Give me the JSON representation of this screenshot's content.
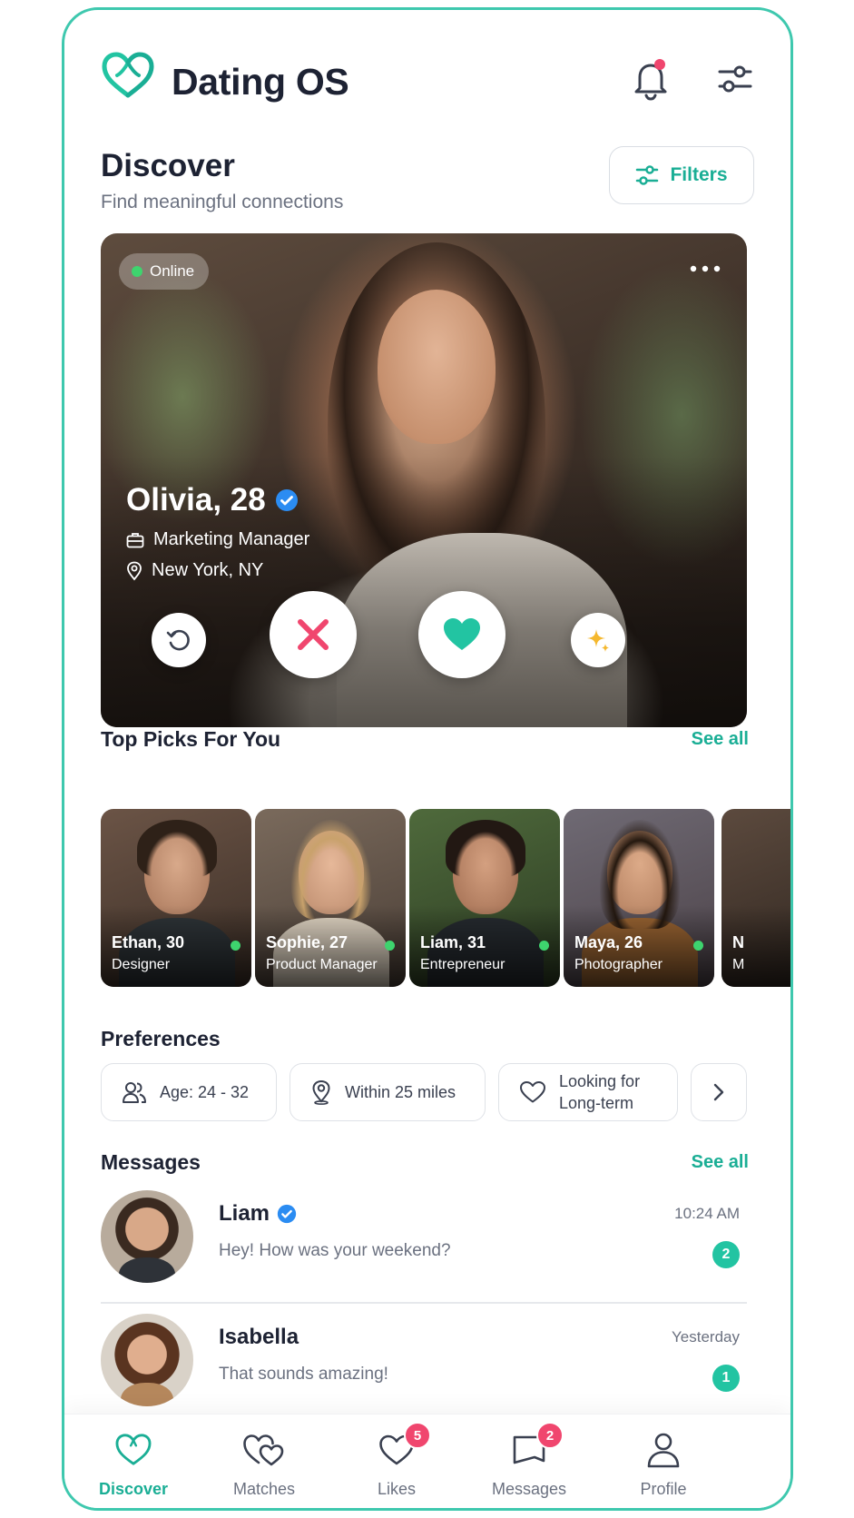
{
  "app": {
    "title": "Dating OS",
    "accent": "#1aae95",
    "notification_color": "#f0466e"
  },
  "header": {
    "icons": [
      "heart-logo-icon",
      "bell-icon",
      "sliders-icon"
    ]
  },
  "discover": {
    "title": "Discover",
    "subtitle": "Find meaningful connections",
    "filters_label": "Filters"
  },
  "hero": {
    "status": "Online",
    "name_age": "Olivia, 28",
    "verified": true,
    "job": "Marketing Manager",
    "location": "New York, NY",
    "actions": [
      "rewind",
      "pass",
      "like",
      "super-like"
    ]
  },
  "top_picks": {
    "title": "Top Picks For You",
    "see_all": "See all",
    "items": [
      {
        "name": "Ethan, 30",
        "role": "Designer",
        "online": true
      },
      {
        "name": "Sophie, 27",
        "role": "Product Manager",
        "online": true
      },
      {
        "name": "Liam, 31",
        "role": "Entrepreneur",
        "online": true
      },
      {
        "name": "Maya, 26",
        "role": "Photographer",
        "online": true
      },
      {
        "name": "N",
        "role": "M",
        "online": false
      }
    ]
  },
  "preferences": {
    "title": "Preferences",
    "chips": [
      {
        "label": "Age: 24 - 32",
        "icon": "users-icon"
      },
      {
        "label": "Within 25 miles",
        "icon": "location-pin-icon"
      },
      {
        "label": "Looking for Long-term",
        "line1": "Looking for",
        "line2": "Long-term",
        "icon": "heart-outline-icon"
      }
    ]
  },
  "messages": {
    "title": "Messages",
    "see_all": "See all",
    "items": [
      {
        "name": "Liam",
        "verified": true,
        "preview": "Hey! How was your weekend?",
        "time": "10:24 AM",
        "unread": "2"
      },
      {
        "name": "Isabella",
        "verified": false,
        "preview": "That sounds amazing!",
        "time": "Yesterday",
        "unread": "1"
      }
    ]
  },
  "nav": {
    "items": [
      {
        "label": "Discover",
        "active": true
      },
      {
        "label": "Matches",
        "active": false
      },
      {
        "label": "Likes",
        "badge": "5"
      },
      {
        "label": "Messages",
        "badge": "2"
      },
      {
        "label": "Profile"
      }
    ]
  }
}
